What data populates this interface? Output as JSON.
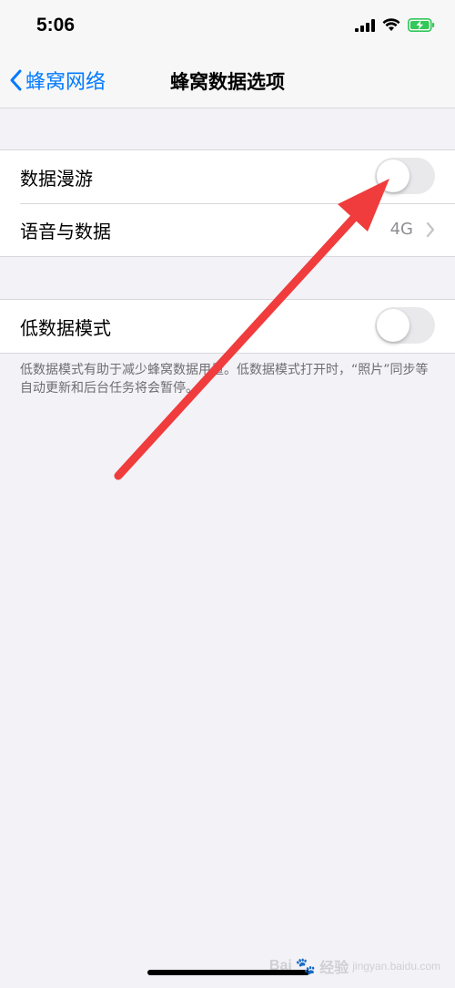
{
  "status_bar": {
    "time": "5:06",
    "icons": [
      "cellular-signal-icon",
      "wifi-icon",
      "battery-charging-icon"
    ]
  },
  "nav": {
    "back_label": "蜂窝网络",
    "title": "蜂窝数据选项"
  },
  "group1": {
    "rows": [
      {
        "label": "数据漫游",
        "toggle_on": false
      },
      {
        "label": "语音与数据",
        "value": "4G"
      }
    ]
  },
  "group2": {
    "rows": [
      {
        "label": "低数据模式",
        "toggle_on": false
      }
    ],
    "footer": "低数据模式有助于减少蜂窝数据用量。低数据模式打开时，“照片”同步等自动更新和后台任务将会暂停。"
  },
  "watermark": {
    "brand_prefix": "Bai",
    "brand_suffix": "经验",
    "subtext": "jingyan.baidu.com"
  },
  "colors": {
    "accent": "#007aff",
    "background": "#f2f2f7",
    "annotation_arrow": "#f03c3c",
    "toggle_off": "#e9e9eb"
  }
}
